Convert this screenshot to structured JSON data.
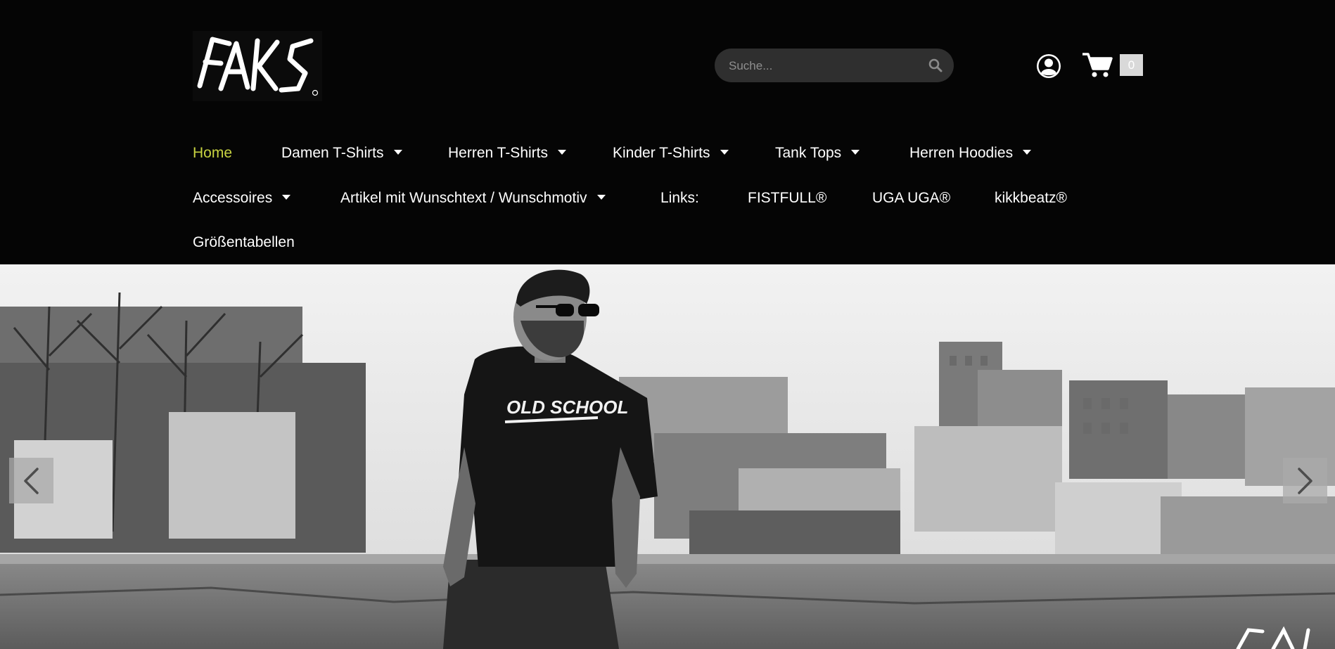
{
  "logo": {
    "text": "FAKS"
  },
  "search": {
    "placeholder": "Suche..."
  },
  "cart": {
    "count": "0"
  },
  "nav": {
    "home": "Home",
    "damen": "Damen T-Shirts",
    "herren": "Herren T-Shirts",
    "kinder": "Kinder T-Shirts",
    "tank": "Tank Tops",
    "hoodies": "Herren Hoodies",
    "accessoires": "Accessoires",
    "wunsch": "Artikel mit Wunschtext / Wunschmotiv",
    "links": "Links:",
    "fistfull": "FISTFULL®",
    "uga": "UGA UGA®",
    "kikkbeatz": "kikkbeatz®",
    "groessen": "Größentabellen"
  },
  "hero": {
    "shirt_print": "OLD SCHOOL"
  },
  "colors": {
    "background": "#050505",
    "active_nav": "#c8d341",
    "nav_text": "#ffffff",
    "search_bg": "#2f2f2f"
  },
  "icons": [
    "search-icon",
    "account-icon",
    "cart-icon",
    "chevron-left-icon",
    "chevron-right-icon",
    "caret-down-icon"
  ]
}
